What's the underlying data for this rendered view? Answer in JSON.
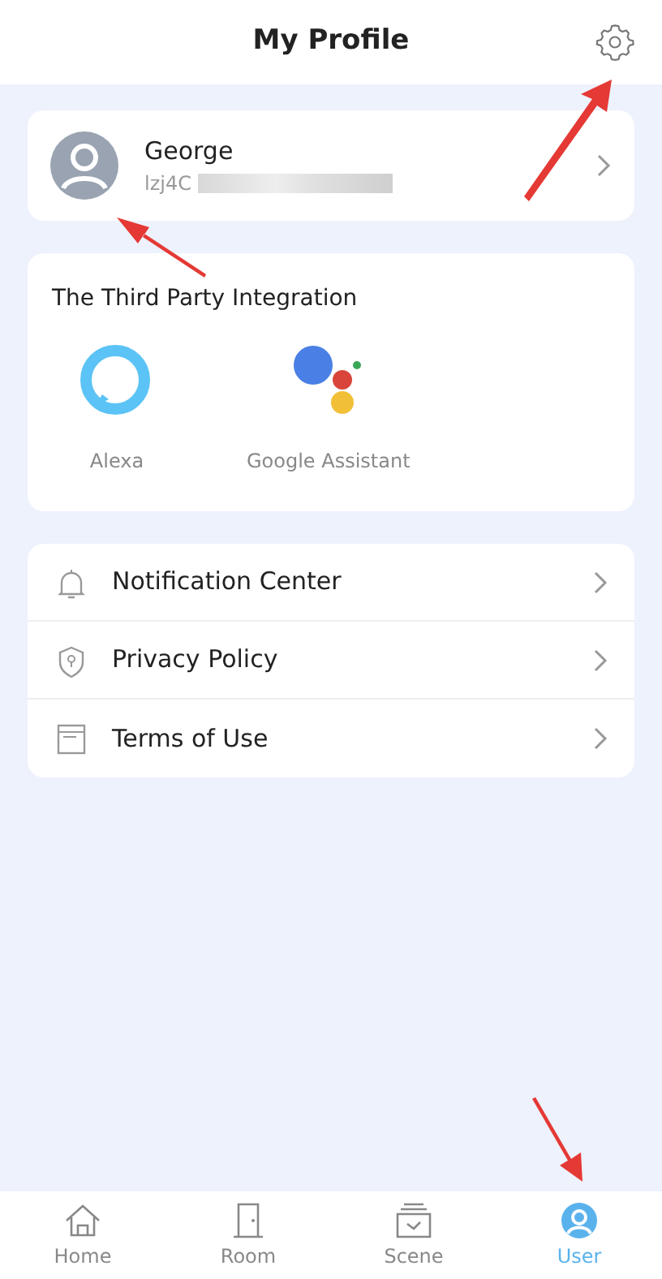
{
  "header": {
    "title": "My Profile"
  },
  "profile": {
    "name": "George",
    "account": "lzj4C"
  },
  "integration": {
    "title": "The Third Party Integration",
    "services": [
      {
        "kind": "alexa",
        "label": "Alexa"
      },
      {
        "kind": "google",
        "label": "Google Assistant"
      }
    ]
  },
  "menu": [
    {
      "kind": "bell",
      "label": "Notification Center"
    },
    {
      "kind": "shield",
      "label": "Privacy Policy"
    },
    {
      "kind": "document",
      "label": "Terms of Use"
    }
  ],
  "tabs": [
    {
      "kind": "home",
      "label": "Home",
      "selected": false
    },
    {
      "kind": "room",
      "label": "Room",
      "selected": false
    },
    {
      "kind": "scene",
      "label": "Scene",
      "selected": false
    },
    {
      "kind": "user",
      "label": "User",
      "selected": true
    }
  ]
}
